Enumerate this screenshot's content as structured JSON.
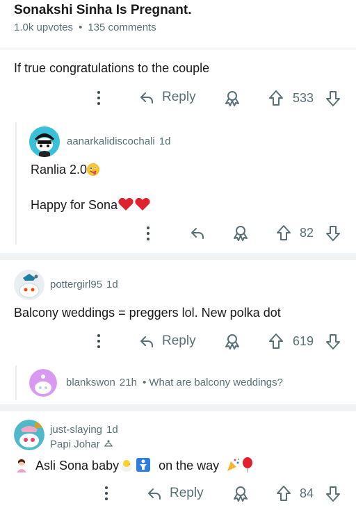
{
  "post": {
    "title": "Sonakshi Sinha Is Pregnant.",
    "upvotes": "1.0k upvotes",
    "separator": "•",
    "comments": "135 comments"
  },
  "comments": [
    {
      "body": "If true congratulations to the couple",
      "reply_label": "Reply",
      "score": "533"
    },
    {
      "username": "aanarkalidiscochali",
      "age": "1d",
      "line1": "Ranlia 2.0",
      "line1_emoji": "zany-face",
      "line2": "Happy for Sona",
      "line2_emoji": "red-heart red-heart",
      "score": "82"
    },
    {
      "username": "pottergirl95",
      "age": "1d",
      "body": "Balcony weddings = preggers lol. New polka dot",
      "reply_label": "Reply",
      "score": "619"
    },
    {
      "username": "blankswon",
      "age": "21h",
      "bullet": "•",
      "preview": "What are balcony weddings?"
    },
    {
      "username": "just-slaying",
      "age": "1d",
      "flair": "Papi Johar",
      "body_a": "Asli Sona baby",
      "body_b": "on the way",
      "reply_label": "Reply",
      "score": "84"
    }
  ],
  "colors": {
    "text": "#1a1a1b",
    "meta": "#576f76",
    "divider": "#e6e6e6",
    "section_bg": "#f0f2f4"
  }
}
